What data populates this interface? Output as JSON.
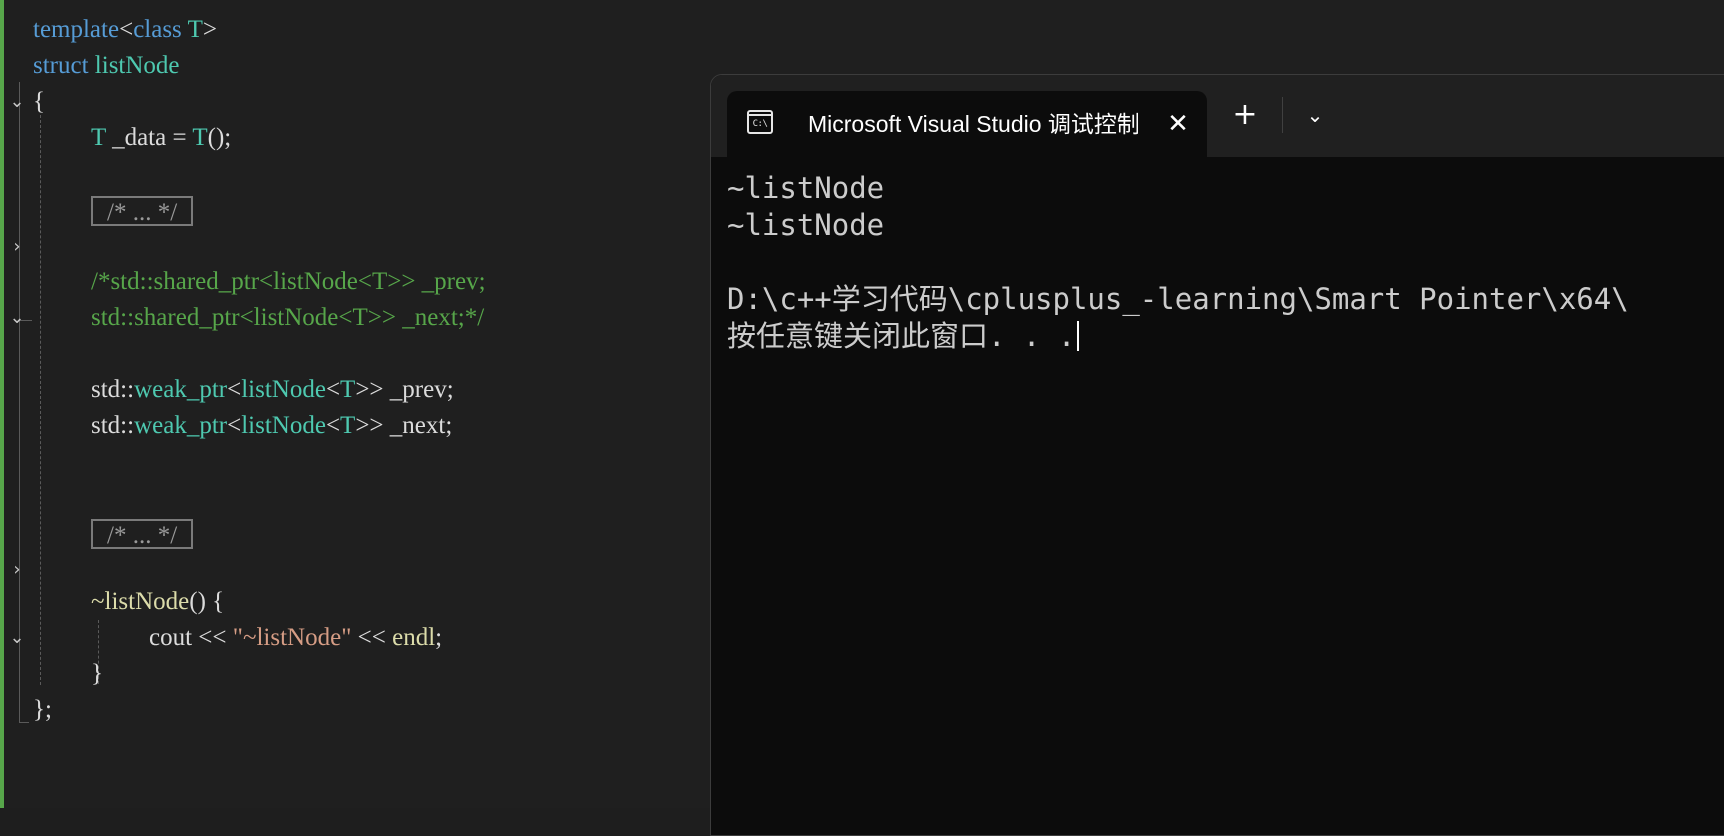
{
  "editor": {
    "lines": {
      "l1": {
        "kw1": "template",
        "p1": "<",
        "kw2": "class",
        "sp": " ",
        "ty1": "T",
        "p2": ">"
      },
      "l2": {
        "kw1": "struct",
        "sp": " ",
        "ty1": "listNode"
      },
      "l3": {
        "p1": "{"
      },
      "l4": {
        "ty1": "T",
        "p1": " _data = ",
        "ty2": "T",
        "p2": "();"
      },
      "l5": {
        "collapsed": "/* ... */"
      },
      "l6": {
        "cm": "/*std::shared_ptr<listNode<T>> _prev;"
      },
      "l7": {
        "cm": "std::shared_ptr<listNode<T>> _next;*/"
      },
      "l8": {
        "p1": "std::",
        "ty1": "weak_ptr",
        "p2": "<",
        "ty2": "listNode",
        "p3": "<",
        "ty3": "T",
        "p4": ">> _prev;"
      },
      "l9": {
        "p1": "std::",
        "ty1": "weak_ptr",
        "p2": "<",
        "ty2": "listNode",
        "p3": "<",
        "ty3": "T",
        "p4": ">> _next;"
      },
      "l10": {
        "collapsed": "/* ... */"
      },
      "l11": {
        "fn": "~listNode",
        "p1": "() {"
      },
      "l12": {
        "p1": "cout << ",
        "str": "\"~listNode\"",
        "p2": " << ",
        "fn": "endl",
        "p3": ";"
      },
      "l13": {
        "p1": "}"
      },
      "l14": {
        "p1": "};"
      }
    },
    "fold_icons": {
      "expanded": "⌄",
      "collapsed": "›"
    }
  },
  "terminal": {
    "tab_title": "Microsoft Visual Studio 调试控制台",
    "tab_icon_text": "C:\\",
    "close_glyph": "✕",
    "new_tab_glyph": "+",
    "dropdown_glyph": "⌄",
    "output": [
      "~listNode",
      "~listNode",
      "",
      "D:\\c++学习代码\\cplusplus_-learning\\Smart Pointer\\x64\\",
      "按任意键关闭此窗口. . ."
    ]
  }
}
